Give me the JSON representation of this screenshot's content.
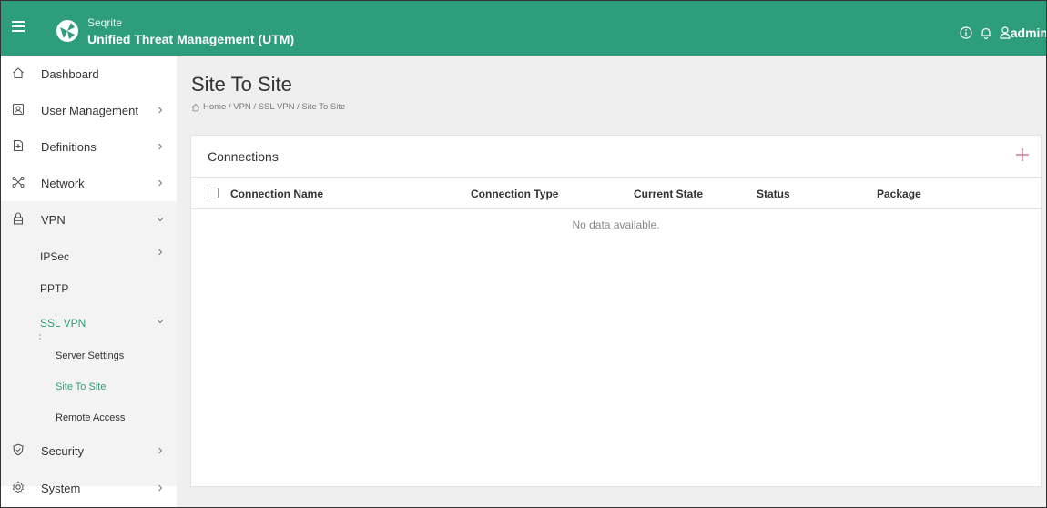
{
  "header": {
    "brand": "Seqrite",
    "product": "Unified Threat Management (UTM)",
    "user": "admin"
  },
  "sidebar": {
    "items": [
      {
        "label": "Dashboard",
        "icon": "home-icon"
      },
      {
        "label": "User Management",
        "icon": "user-card-icon"
      },
      {
        "label": "Definitions",
        "icon": "definitions-icon"
      },
      {
        "label": "Network",
        "icon": "network-icon"
      },
      {
        "label": "VPN",
        "icon": "lock-icon"
      },
      {
        "label": "Security",
        "icon": "shield-icon"
      },
      {
        "label": "System",
        "icon": "gear-icon"
      }
    ],
    "vpn_sub": {
      "ipsec": "IPSec",
      "pptp": "PPTP",
      "sslvpn": "SSL VPN"
    },
    "ssl_sub": {
      "server_settings": "Server Settings",
      "site_to_site": "Site To Site",
      "remote_access": "Remote Access"
    }
  },
  "page": {
    "title": "Site To Site",
    "breadcrumb": "Home / VPN / SSL VPN / Site To Site"
  },
  "card": {
    "title": "Connections",
    "columns": [
      "Connection Name",
      "Connection Type",
      "Current State",
      "Status",
      "Package"
    ],
    "empty_text": "No data available."
  },
  "colors": {
    "accent": "#2e9d7c",
    "sidebar_active_bg": "#f3f3f3",
    "add_icon": "#c0577f"
  }
}
